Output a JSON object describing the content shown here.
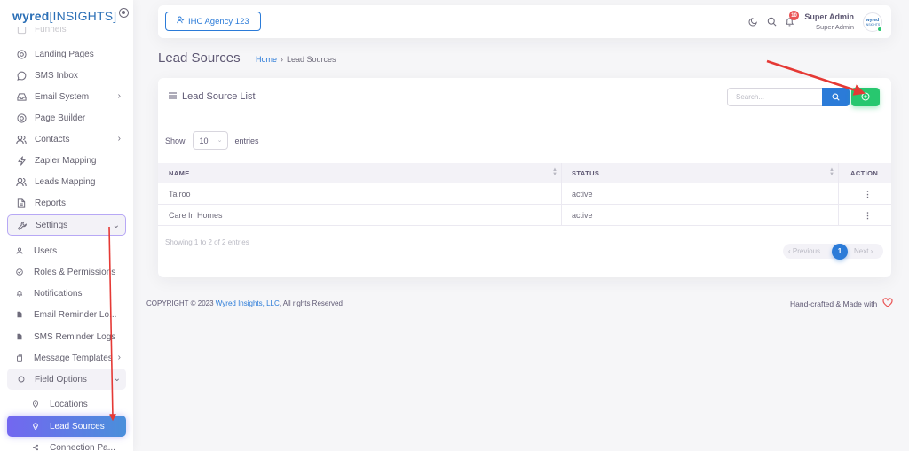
{
  "brand": {
    "logo_main": "wyred",
    "logo_insights": "[INSIGHTS]"
  },
  "sidebar": {
    "items": [
      {
        "label": "Funnels",
        "icon": "funnel-icon"
      },
      {
        "label": "Landing Pages",
        "icon": "chrome-icon"
      },
      {
        "label": "SMS Inbox",
        "icon": "message-circle-icon"
      },
      {
        "label": "Email System",
        "icon": "inbox-icon"
      },
      {
        "label": "Page Builder",
        "icon": "chrome-icon"
      },
      {
        "label": "Contacts",
        "icon": "users-icon"
      },
      {
        "label": "Zapier Mapping",
        "icon": "zap-icon"
      },
      {
        "label": "Leads Mapping",
        "icon": "users-icon"
      },
      {
        "label": "Reports",
        "icon": "file-text-icon"
      },
      {
        "label": "Settings",
        "icon": "tool-icon"
      },
      {
        "label": "Users",
        "icon": "user-icon"
      },
      {
        "label": "Roles & Permissions",
        "icon": "check-circle-icon"
      },
      {
        "label": "Notifications",
        "icon": "bell-icon"
      },
      {
        "label": "Email Reminder Lo...",
        "icon": "file-icon"
      },
      {
        "label": "SMS Reminder Logs",
        "icon": "file-icon"
      },
      {
        "label": "Message Templates",
        "icon": "copy-icon"
      },
      {
        "label": "Field Options",
        "icon": "circle-icon"
      },
      {
        "label": "Locations",
        "icon": "map-pin-icon"
      },
      {
        "label": "Lead Sources",
        "icon": "lightbulb-icon"
      },
      {
        "label": "Connection Pa...",
        "icon": "share-icon"
      }
    ]
  },
  "navbar": {
    "agency_label": "IHC Agency 123",
    "notification_count": "10",
    "user_name": "Super Admin",
    "user_role": "Super Admin",
    "avatar_text_1": "wyred",
    "avatar_text_2": "INSIGHTS"
  },
  "header": {
    "title": "Lead Sources",
    "breadcrumb_home": "Home",
    "breadcrumb_current": "Lead Sources"
  },
  "card": {
    "title": "Lead Source List",
    "search_placeholder": "Search...",
    "show_label": "Show",
    "entries_value": "10",
    "entries_label": "entries",
    "columns": [
      "NAME",
      "STATUS",
      "ACTION"
    ],
    "rows": [
      {
        "name": "Talroo",
        "status": "active"
      },
      {
        "name": "Care In Homes",
        "status": "active"
      }
    ],
    "info": "Showing 1 to 2 of 2 entries",
    "pager": {
      "prev": "‹ Previous",
      "page": "1",
      "next": "Next ›"
    }
  },
  "footer": {
    "copyright": "COPYRIGHT © 2023",
    "company": "Wyred Insights, LLC",
    "rights": ", All rights Reserved",
    "crafted": "Hand-crafted & Made with"
  },
  "colors": {
    "primary": "#2b7bd8",
    "success": "#28c76f",
    "danger": "#ea5455",
    "active_gradient_start": "#7367f0",
    "annotation": "#e53935"
  }
}
